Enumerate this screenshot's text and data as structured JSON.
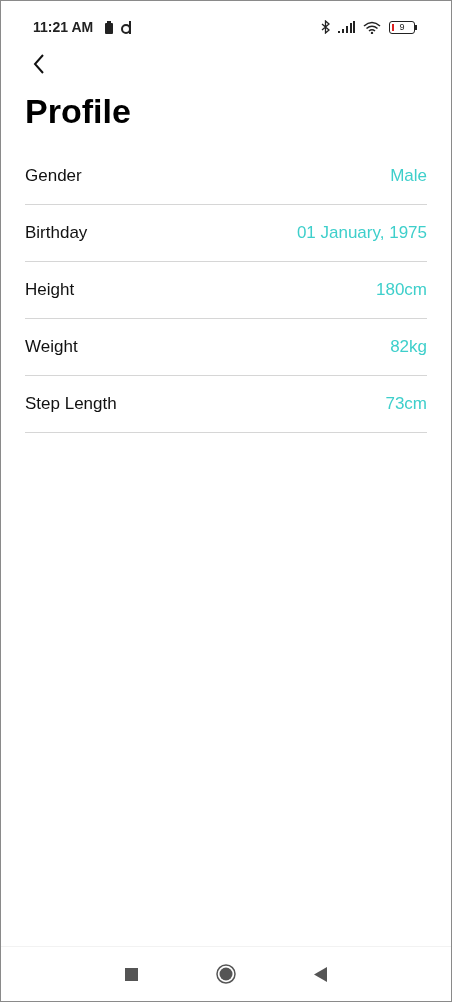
{
  "status_bar": {
    "time": "11:21 AM",
    "battery_level": "9"
  },
  "title": "Profile",
  "fields": [
    {
      "label": "Gender",
      "value": "Male"
    },
    {
      "label": "Birthday",
      "value": "01 January, 1975"
    },
    {
      "label": "Height",
      "value": "180cm"
    },
    {
      "label": "Weight",
      "value": "82kg"
    },
    {
      "label": "Step Length",
      "value": "73cm"
    }
  ]
}
